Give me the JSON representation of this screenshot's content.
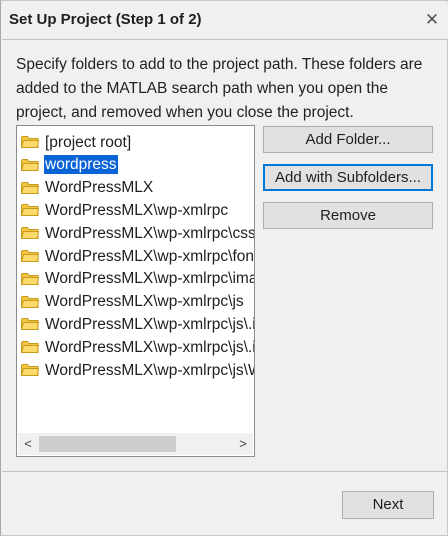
{
  "dialog": {
    "title": "Set Up Project (Step 1 of 2)",
    "close_glyph": "✕",
    "description": "Specify folders to add to the project path. These folders are added to the MATLAB search path when you open the project, and removed when you close the project."
  },
  "folders": {
    "items": [
      {
        "label": "[project root]",
        "selected": false
      },
      {
        "label": "wordpress",
        "selected": true
      },
      {
        "label": "WordPressMLX",
        "selected": false
      },
      {
        "label": "WordPressMLX\\wp-xmlrpc",
        "selected": false
      },
      {
        "label": "WordPressMLX\\wp-xmlrpc\\css",
        "selected": false
      },
      {
        "label": "WordPressMLX\\wp-xmlrpc\\font",
        "selected": false
      },
      {
        "label": "WordPressMLX\\wp-xmlrpc\\imag",
        "selected": false
      },
      {
        "label": "WordPressMLX\\wp-xmlrpc\\js",
        "selected": false
      },
      {
        "label": "WordPressMLX\\wp-xmlrpc\\js\\.ic",
        "selected": false
      },
      {
        "label": "WordPressMLX\\wp-xmlrpc\\js\\.ic",
        "selected": false
      },
      {
        "label": "WordPressMLX\\wp-xmlrpc\\js\\W",
        "selected": false
      }
    ],
    "scroll_left_glyph": "<",
    "scroll_right_glyph": ">",
    "folder_icon_color": "#f5c542"
  },
  "buttons": {
    "add_folder": "Add Folder...",
    "add_with_subfolders": "Add with Subfolders...",
    "remove": "Remove",
    "next": "Next"
  },
  "colors": {
    "selection": "#0a64d6",
    "focus_border": "#0078d7"
  }
}
